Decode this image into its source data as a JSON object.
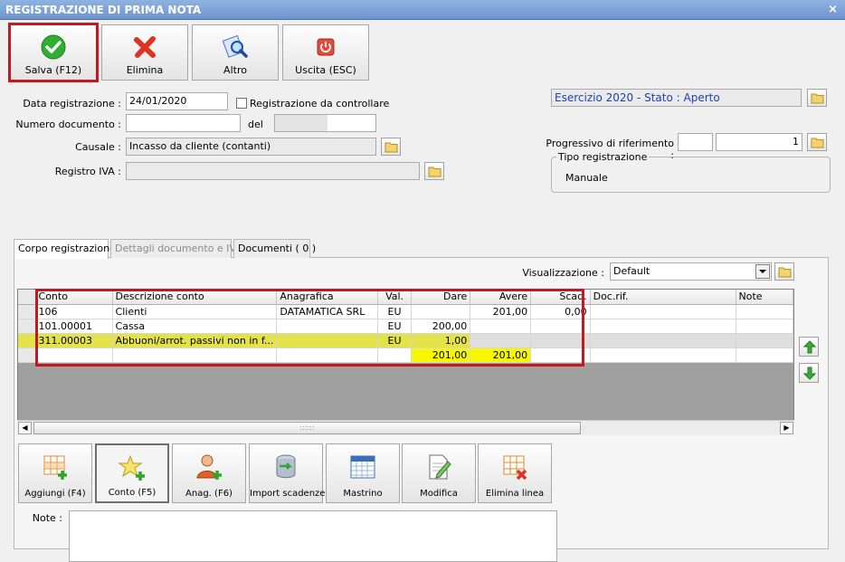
{
  "window": {
    "title": "REGISTRAZIONE DI PRIMA NOTA",
    "close_glyph": "×"
  },
  "toolbar": [
    {
      "label": "Salva (F12)",
      "icon": "check-icon",
      "color": "#2fae2f"
    },
    {
      "label": "Elimina",
      "icon": "x-icon",
      "color": "#e03222"
    },
    {
      "label": "Altro",
      "icon": "search-icon",
      "color": "#3b74c7"
    },
    {
      "label": "Uscita (ESC)",
      "icon": "power-icon",
      "color": "#e04b3a"
    }
  ],
  "form": {
    "data_registrazione_label": "Data registrazione :",
    "data_registrazione": "24/01/2020",
    "registrazione_controllare_label": "Registrazione da controllare",
    "numero_documento_label": "Numero documento :",
    "numero_documento": "",
    "del_label": "del",
    "del_value": "",
    "causale_label": "Causale :",
    "causale": "Incasso da cliente (contanti)",
    "registro_iva_label": "Registro IVA :",
    "registro_iva": "",
    "esercizio": "Esercizio 2020 - Stato : Aperto",
    "progressivo_label": "Progressivo di riferimento :",
    "progressivo_a": "",
    "progressivo_b": "1",
    "tipo_registrazione_label": "Tipo registrazione",
    "tipo_registrazione": "Manuale"
  },
  "tabs": [
    {
      "label": "Corpo registrazione"
    },
    {
      "label": "Dettagli documento e IVA"
    },
    {
      "label": "Documenti ( 0 )"
    }
  ],
  "visualizzazione": {
    "label": "Visualizzazione :",
    "value": "Default"
  },
  "grid": {
    "columns": [
      "Conto",
      "Descrizione conto",
      "Anagrafica",
      "Val.",
      "Dare",
      "Avere",
      "Scad.",
      "Doc.rif.",
      "Note"
    ],
    "rows": [
      {
        "conto": "106",
        "descrizione": "Clienti",
        "anagrafica": "DATAMATICA SRL",
        "val": "EU",
        "dare": "",
        "avere": "201,00",
        "scad": "0,00",
        "docrif": "",
        "note": ""
      },
      {
        "conto": "101.00001",
        "descrizione": "Cassa",
        "anagrafica": "",
        "val": "EU",
        "dare": "200,00",
        "avere": "",
        "scad": "",
        "docrif": "",
        "note": ""
      },
      {
        "conto": "311.00003",
        "descrizione": "Abbuoni/arrot. passivi non in f...",
        "anagrafica": "",
        "val": "EU",
        "dare": "1,00",
        "avere": "",
        "scad": "",
        "docrif": "",
        "note": ""
      }
    ],
    "totals": {
      "dare": "201,00",
      "avere": "201,00"
    },
    "scroll_grip": "::::::"
  },
  "bottom_buttons": [
    {
      "label": "Aggiungi (F4)",
      "icon": "add-row-icon"
    },
    {
      "label": "Conto (F5)",
      "icon": "star-add-icon"
    },
    {
      "label": "Anag. (F6)",
      "icon": "user-add-icon"
    },
    {
      "label": "Import scadenze",
      "icon": "database-import-icon"
    },
    {
      "label": "Mastrino",
      "icon": "calendar-icon"
    },
    {
      "label": "Modifica",
      "icon": "edit-document-icon"
    },
    {
      "label": "Elimina linea",
      "icon": "delete-row-icon"
    }
  ],
  "note": {
    "label": "Note :",
    "value": ""
  },
  "colors": {
    "highlight": "#c8161e",
    "selected_row": "#e4e24a",
    "totals": "#f7f700",
    "esercizio_text": "#1f3fbf"
  }
}
